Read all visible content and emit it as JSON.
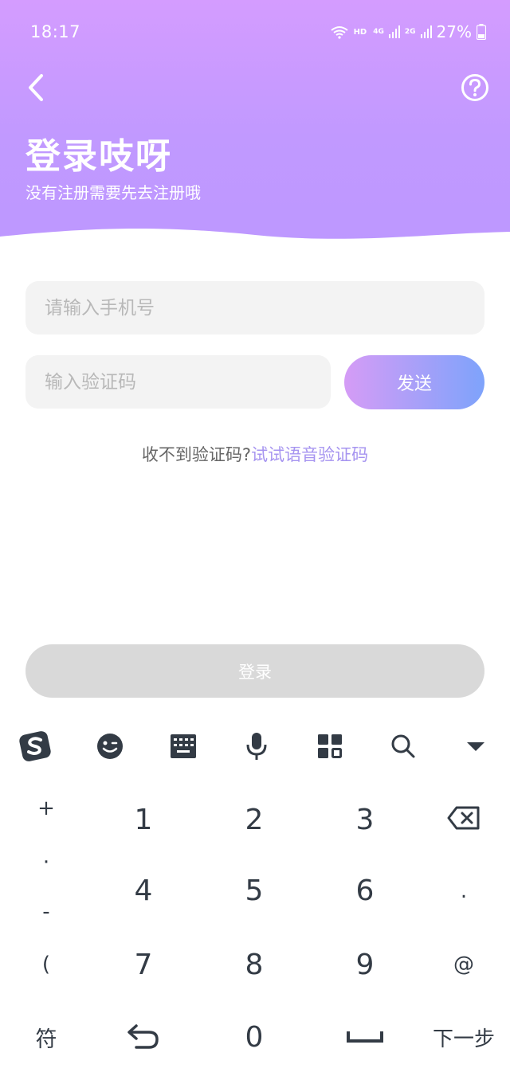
{
  "status_bar": {
    "time": "18:17",
    "hd": "HD",
    "net1": "4G",
    "net2": "2G",
    "battery": "27%"
  },
  "header": {
    "title": "登录吱呀",
    "subtitle": "没有注册需要先去注册哦"
  },
  "form": {
    "phone_placeholder": "请输入手机号",
    "code_placeholder": "输入验证码",
    "send_label": "发送",
    "voice_prompt": "收不到验证码?",
    "voice_link": "试试语音验证码",
    "login_label": "登录"
  },
  "keyboard": {
    "left_column": [
      "+",
      "·",
      "-",
      "("
    ],
    "digits": [
      "1",
      "2",
      "3",
      "4",
      "5",
      "6",
      "7",
      "8",
      "9",
      "0"
    ],
    "right_column": [
      ".",
      "@"
    ],
    "symbols_key": "符",
    "next_key": "下一步",
    "toolbar_icons": [
      "sogou-logo-icon",
      "emoji-icon",
      "keyboard-icon",
      "mic-icon",
      "grid-icon",
      "search-icon",
      "collapse-icon"
    ]
  },
  "colors": {
    "header_start": "#d49cff",
    "header_end": "#bd98ff",
    "send_start": "#d59cf6",
    "send_end": "#7ea3fb",
    "link": "#a694f0",
    "login_disabled": "#d9d9d9"
  }
}
